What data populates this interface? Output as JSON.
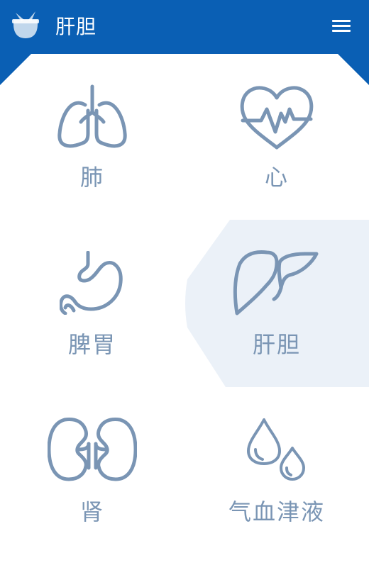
{
  "header": {
    "title": "肝胆",
    "color": "#0a5fb4"
  },
  "menu_icon": "hamburger-menu-icon",
  "accent_icon_color": "#7a95b4",
  "selected_bg_color": "#ebf1f8",
  "items": [
    {
      "label": "肺",
      "icon": "lungs-icon"
    },
    {
      "label": "心",
      "icon": "heart-pulse-icon"
    },
    {
      "label": "脾胃",
      "icon": "stomach-icon"
    },
    {
      "label": "肝胆",
      "icon": "liver-icon",
      "selected": true
    },
    {
      "label": "肾",
      "icon": "kidneys-icon"
    },
    {
      "label": "气血津液",
      "icon": "drops-icon"
    }
  ]
}
